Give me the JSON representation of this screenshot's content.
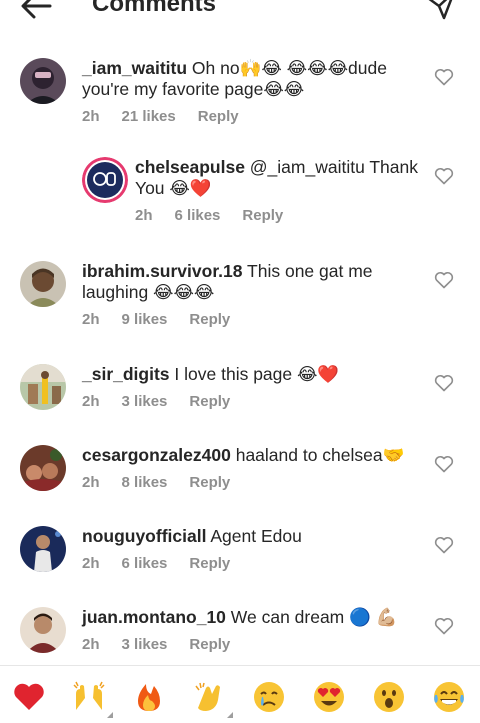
{
  "header": {
    "title": "Comments"
  },
  "comments": [
    {
      "username": "_iam_waititu",
      "text": " Oh no🙌😂 😂😂😂dude you're my favorite page😂😂",
      "time": "2h",
      "likes": "21 likes",
      "reply": "Reply"
    },
    {
      "username": "chelseapulse",
      "text": " @_iam_waititu Thank You 😂❤️",
      "time": "2h",
      "likes": "6 likes",
      "reply": "Reply"
    },
    {
      "username": "ibrahim.survivor.18",
      "text": " This one gat me laughing 😂😂😂",
      "time": "2h",
      "likes": "9 likes",
      "reply": "Reply"
    },
    {
      "username": "_sir_digits",
      "text": " I love this page 😂❤️",
      "time": "2h",
      "likes": "3 likes",
      "reply": "Reply"
    },
    {
      "username": "cesargonzalez400",
      "text": " haaland to chelsea🤝",
      "time": "2h",
      "likes": "8 likes",
      "reply": "Reply"
    },
    {
      "username": "nouguyofficiall",
      "text": " Agent Edou",
      "time": "2h",
      "likes": "6 likes",
      "reply": "Reply"
    },
    {
      "username": "juan.montano_10",
      "text": " We can dream 🔵 💪🏼",
      "time": "2h",
      "likes": "3 likes",
      "reply": "Reply"
    }
  ],
  "emoji_bar": [
    "heart",
    "raising-hands",
    "fire",
    "clapping-hands",
    "crying-face",
    "heart-eyes",
    "surprised-face",
    "tears-of-joy"
  ]
}
